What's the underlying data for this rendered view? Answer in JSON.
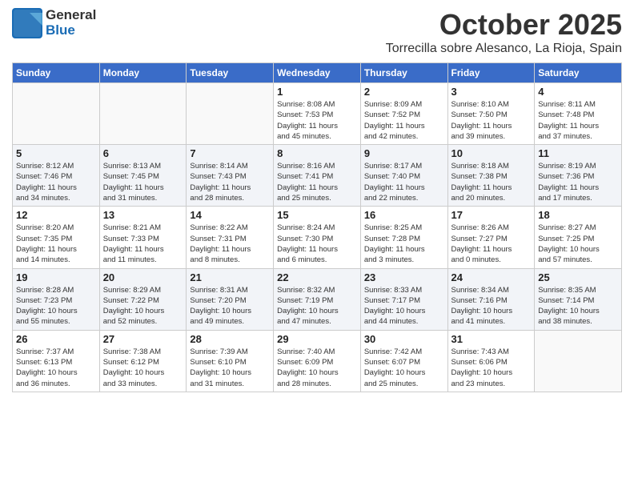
{
  "header": {
    "logo_general": "General",
    "logo_blue": "Blue",
    "month": "October 2025",
    "location": "Torrecilla sobre Alesanco, La Rioja, Spain"
  },
  "weekdays": [
    "Sunday",
    "Monday",
    "Tuesday",
    "Wednesday",
    "Thursday",
    "Friday",
    "Saturday"
  ],
  "weeks": [
    [
      {
        "day": "",
        "info": ""
      },
      {
        "day": "",
        "info": ""
      },
      {
        "day": "",
        "info": ""
      },
      {
        "day": "1",
        "info": "Sunrise: 8:08 AM\nSunset: 7:53 PM\nDaylight: 11 hours\nand 45 minutes."
      },
      {
        "day": "2",
        "info": "Sunrise: 8:09 AM\nSunset: 7:52 PM\nDaylight: 11 hours\nand 42 minutes."
      },
      {
        "day": "3",
        "info": "Sunrise: 8:10 AM\nSunset: 7:50 PM\nDaylight: 11 hours\nand 39 minutes."
      },
      {
        "day": "4",
        "info": "Sunrise: 8:11 AM\nSunset: 7:48 PM\nDaylight: 11 hours\nand 37 minutes."
      }
    ],
    [
      {
        "day": "5",
        "info": "Sunrise: 8:12 AM\nSunset: 7:46 PM\nDaylight: 11 hours\nand 34 minutes."
      },
      {
        "day": "6",
        "info": "Sunrise: 8:13 AM\nSunset: 7:45 PM\nDaylight: 11 hours\nand 31 minutes."
      },
      {
        "day": "7",
        "info": "Sunrise: 8:14 AM\nSunset: 7:43 PM\nDaylight: 11 hours\nand 28 minutes."
      },
      {
        "day": "8",
        "info": "Sunrise: 8:16 AM\nSunset: 7:41 PM\nDaylight: 11 hours\nand 25 minutes."
      },
      {
        "day": "9",
        "info": "Sunrise: 8:17 AM\nSunset: 7:40 PM\nDaylight: 11 hours\nand 22 minutes."
      },
      {
        "day": "10",
        "info": "Sunrise: 8:18 AM\nSunset: 7:38 PM\nDaylight: 11 hours\nand 20 minutes."
      },
      {
        "day": "11",
        "info": "Sunrise: 8:19 AM\nSunset: 7:36 PM\nDaylight: 11 hours\nand 17 minutes."
      }
    ],
    [
      {
        "day": "12",
        "info": "Sunrise: 8:20 AM\nSunset: 7:35 PM\nDaylight: 11 hours\nand 14 minutes."
      },
      {
        "day": "13",
        "info": "Sunrise: 8:21 AM\nSunset: 7:33 PM\nDaylight: 11 hours\nand 11 minutes."
      },
      {
        "day": "14",
        "info": "Sunrise: 8:22 AM\nSunset: 7:31 PM\nDaylight: 11 hours\nand 8 minutes."
      },
      {
        "day": "15",
        "info": "Sunrise: 8:24 AM\nSunset: 7:30 PM\nDaylight: 11 hours\nand 6 minutes."
      },
      {
        "day": "16",
        "info": "Sunrise: 8:25 AM\nSunset: 7:28 PM\nDaylight: 11 hours\nand 3 minutes."
      },
      {
        "day": "17",
        "info": "Sunrise: 8:26 AM\nSunset: 7:27 PM\nDaylight: 11 hours\nand 0 minutes."
      },
      {
        "day": "18",
        "info": "Sunrise: 8:27 AM\nSunset: 7:25 PM\nDaylight: 10 hours\nand 57 minutes."
      }
    ],
    [
      {
        "day": "19",
        "info": "Sunrise: 8:28 AM\nSunset: 7:23 PM\nDaylight: 10 hours\nand 55 minutes."
      },
      {
        "day": "20",
        "info": "Sunrise: 8:29 AM\nSunset: 7:22 PM\nDaylight: 10 hours\nand 52 minutes."
      },
      {
        "day": "21",
        "info": "Sunrise: 8:31 AM\nSunset: 7:20 PM\nDaylight: 10 hours\nand 49 minutes."
      },
      {
        "day": "22",
        "info": "Sunrise: 8:32 AM\nSunset: 7:19 PM\nDaylight: 10 hours\nand 47 minutes."
      },
      {
        "day": "23",
        "info": "Sunrise: 8:33 AM\nSunset: 7:17 PM\nDaylight: 10 hours\nand 44 minutes."
      },
      {
        "day": "24",
        "info": "Sunrise: 8:34 AM\nSunset: 7:16 PM\nDaylight: 10 hours\nand 41 minutes."
      },
      {
        "day": "25",
        "info": "Sunrise: 8:35 AM\nSunset: 7:14 PM\nDaylight: 10 hours\nand 38 minutes."
      }
    ],
    [
      {
        "day": "26",
        "info": "Sunrise: 7:37 AM\nSunset: 6:13 PM\nDaylight: 10 hours\nand 36 minutes."
      },
      {
        "day": "27",
        "info": "Sunrise: 7:38 AM\nSunset: 6:12 PM\nDaylight: 10 hours\nand 33 minutes."
      },
      {
        "day": "28",
        "info": "Sunrise: 7:39 AM\nSunset: 6:10 PM\nDaylight: 10 hours\nand 31 minutes."
      },
      {
        "day": "29",
        "info": "Sunrise: 7:40 AM\nSunset: 6:09 PM\nDaylight: 10 hours\nand 28 minutes."
      },
      {
        "day": "30",
        "info": "Sunrise: 7:42 AM\nSunset: 6:07 PM\nDaylight: 10 hours\nand 25 minutes."
      },
      {
        "day": "31",
        "info": "Sunrise: 7:43 AM\nSunset: 6:06 PM\nDaylight: 10 hours\nand 23 minutes."
      },
      {
        "day": "",
        "info": ""
      }
    ]
  ]
}
